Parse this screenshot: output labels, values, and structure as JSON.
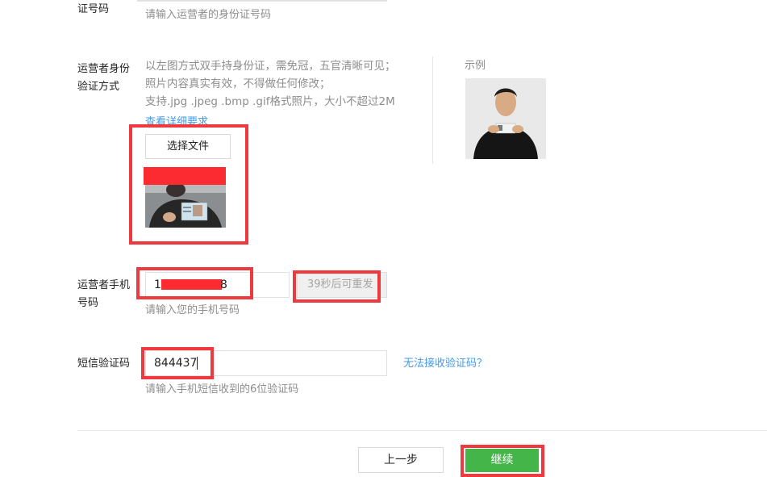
{
  "top_id": {
    "label": "证号码",
    "hint": "请输入运营者的身份证号码"
  },
  "verify": {
    "label_line1": "运营者身份",
    "label_line2": "验证方式",
    "desc_line1": "以左图方式双手持身份证，需免冠，五官清晰可见；",
    "desc_line2": "照片内容真实有效，不得做任何修改；",
    "desc_line3": "支持.jpg .jpeg .bmp .gif格式照片，大小不超过2M",
    "detail_link": "查看详细要求",
    "choose_file_label": "选择文件",
    "example_label": "示例"
  },
  "phone": {
    "label_line1": "运营者手机",
    "label_line2": "号码",
    "value_prefix": "1",
    "value_suffix": "8",
    "resend_label": "39秒后可重发",
    "hint": "请输入您的手机号码"
  },
  "sms": {
    "label": "短信验证码",
    "value": "844437",
    "cannot_receive_link": "无法接收验证码？",
    "hint": "请输入手机短信收到的6位验证码"
  },
  "footer": {
    "prev_label": "上一步",
    "continue_label": "继续"
  },
  "colors": {
    "annotation_red": "#f0383f",
    "primary_green": "#44b549",
    "link_blue": "#459ae9"
  }
}
